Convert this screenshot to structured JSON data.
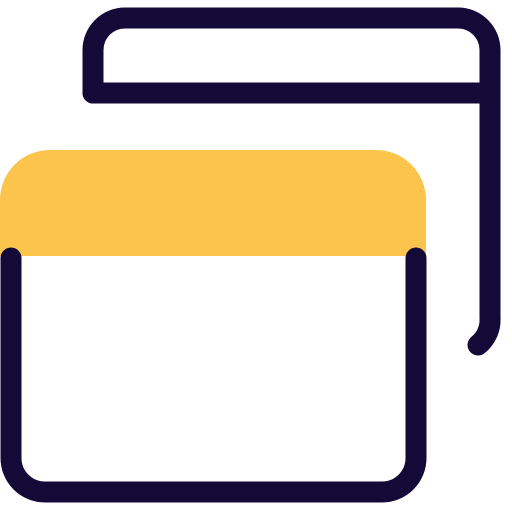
{
  "icon": {
    "name": "multiple-windows-icon",
    "colors": {
      "outline": "#130a38",
      "accent": "#fbc44c",
      "background": "#ffffff"
    }
  }
}
